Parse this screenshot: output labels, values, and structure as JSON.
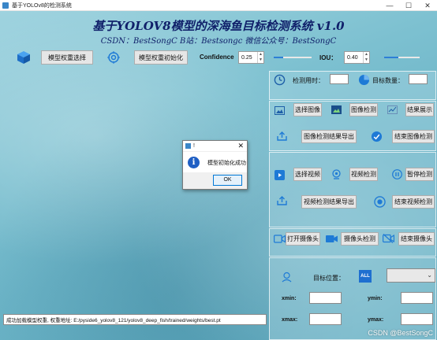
{
  "window": {
    "title": "基于YOLOv8的检测系统",
    "controls": {
      "minimize": "—",
      "maximize": "☐",
      "close": "✕"
    }
  },
  "header": {
    "title": "基于YOLOV8模型的深海鱼目标检测系统 v1.0",
    "subtitle": "CSDN：BestSongC   B站：Bestsongc   微信公众号：BestSongC"
  },
  "toolbar": {
    "model_select": "模型权重选择",
    "model_init": "模型权重初始化",
    "confidence_label": "Confidence",
    "confidence_value": "0.25",
    "confidence_level": 0.25,
    "iou_label": "IOU：",
    "iou_value": "0.40",
    "iou_level": 0.4
  },
  "stats": {
    "period_label": "检测用时：",
    "period_value": "",
    "count_label": "目标数量：",
    "count_value": ""
  },
  "image_panel": {
    "select": "选择图像",
    "detect": "图像检测",
    "show": "结果展示",
    "export": "图像检测结果导出",
    "stop": "结束图像检测"
  },
  "video_panel": {
    "select": "选择视频",
    "detect": "视频检测",
    "pause": "暂停检测",
    "export": "视频检测结果导出",
    "stop": "结束视频检测"
  },
  "camera_panel": {
    "open": "打开摄像头",
    "detect": "摄像头检测",
    "stop": "结束摄像头"
  },
  "target_panel": {
    "position_label": "目标位置：",
    "all_badge": "ALL",
    "select_value": "",
    "xmin_label": "xmin:",
    "ymin_label": "ymin:",
    "xmax_label": "xmax:",
    "ymax_label": "ymax:",
    "xmin": "",
    "ymin": "",
    "xmax": "",
    "ymax": ""
  },
  "status": {
    "text": "成功加载模型权重, 权重地址: E:/pyside6_yolov8_121/yolov8_deep_fish/trained/weights/best.pt"
  },
  "dialog": {
    "title": "!",
    "message": "模型初始化成功",
    "ok": "OK",
    "close": "✕",
    "icon": "i"
  },
  "watermark": "CSDN @BestSongC",
  "colors": {
    "title": "#10206a",
    "accent": "#2d7fd6",
    "icon_blue": "#1e7ad6",
    "background": "#7cc0d0"
  }
}
